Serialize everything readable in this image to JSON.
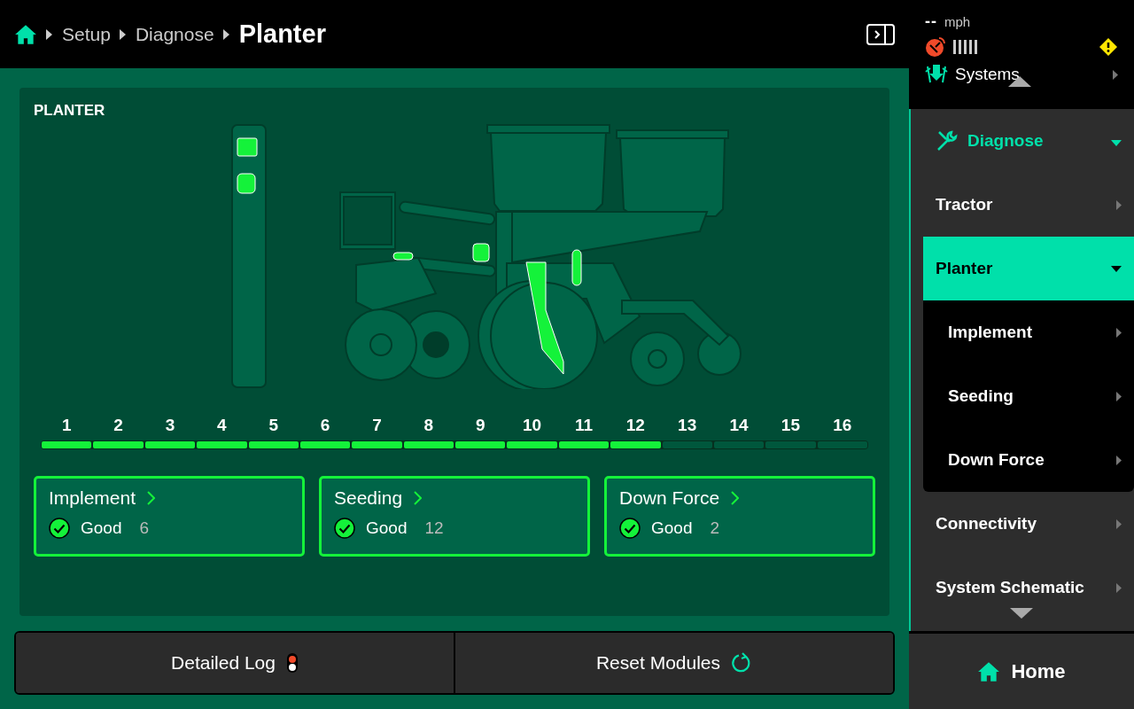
{
  "breadcrumb": [
    "Setup",
    "Diagnose"
  ],
  "title": "Planter",
  "status": {
    "speed": "--",
    "unit": "mph"
  },
  "sidebar": {
    "systems": "Systems",
    "section": {
      "label": "Diagnose",
      "expanded": true
    },
    "items": [
      {
        "label": "Tractor",
        "selected": false,
        "expanded": false
      },
      {
        "label": "Planter",
        "selected": true,
        "expanded": true,
        "children": [
          {
            "label": "Implement"
          },
          {
            "label": "Seeding"
          },
          {
            "label": "Down Force"
          }
        ]
      },
      {
        "label": "Connectivity",
        "selected": false,
        "expanded": false
      },
      {
        "label": "System Schematic",
        "selected": false,
        "expanded": false
      }
    ],
    "home": "Home"
  },
  "panel": {
    "title": "PLANTER"
  },
  "rows": [
    {
      "label": "1",
      "active": true
    },
    {
      "label": "2",
      "active": true
    },
    {
      "label": "3",
      "active": true
    },
    {
      "label": "4",
      "active": true
    },
    {
      "label": "5",
      "active": true
    },
    {
      "label": "6",
      "active": true
    },
    {
      "label": "7",
      "active": true
    },
    {
      "label": "8",
      "active": true
    },
    {
      "label": "9",
      "active": true
    },
    {
      "label": "10",
      "active": true
    },
    {
      "label": "11",
      "active": true
    },
    {
      "label": "12",
      "active": true
    },
    {
      "label": "13",
      "active": false
    },
    {
      "label": "14",
      "active": false
    },
    {
      "label": "15",
      "active": false
    },
    {
      "label": "16",
      "active": false
    }
  ],
  "cards": [
    {
      "title": "Implement",
      "status": "Good",
      "count": "6"
    },
    {
      "title": "Seeding",
      "status": "Good",
      "count": "12"
    },
    {
      "title": "Down Force",
      "status": "Good",
      "count": "2"
    }
  ],
  "buttons": [
    {
      "label": "Detailed Log",
      "kind": "log"
    },
    {
      "label": "Reset Modules",
      "kind": "reset"
    }
  ]
}
